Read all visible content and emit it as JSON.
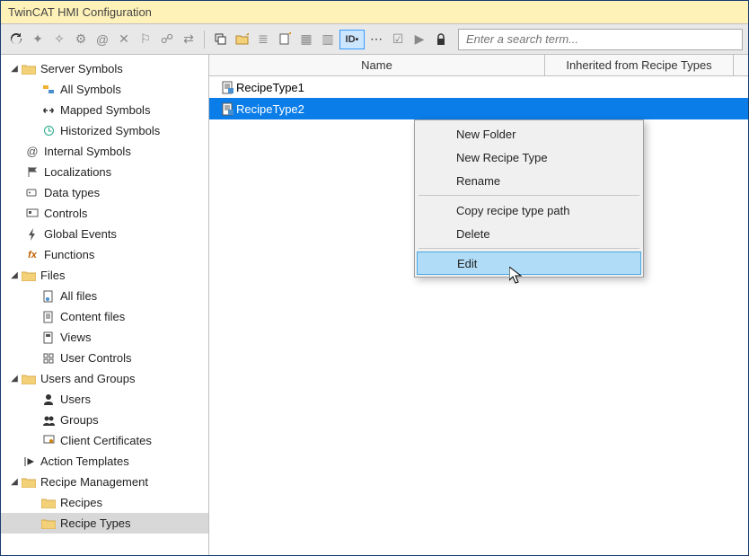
{
  "title": "TwinCAT HMI Configuration",
  "search_placeholder": "Enter a search term...",
  "columns": {
    "name": "Name",
    "inherited": "Inherited from Recipe Types"
  },
  "rows": [
    {
      "label": "RecipeType1"
    },
    {
      "label": "RecipeType2"
    }
  ],
  "context_menu": {
    "new_folder": "New Folder",
    "new_recipe_type": "New Recipe Type",
    "rename": "Rename",
    "copy_path": "Copy recipe type path",
    "delete": "Delete",
    "edit": "Edit"
  },
  "tree": {
    "server_symbols": "Server Symbols",
    "all_symbols": "All Symbols",
    "mapped_symbols": "Mapped Symbols",
    "historized_symbols": "Historized Symbols",
    "internal_symbols": "Internal Symbols",
    "localizations": "Localizations",
    "data_types": "Data types",
    "controls": "Controls",
    "global_events": "Global Events",
    "functions": "Functions",
    "files": "Files",
    "all_files": "All files",
    "content_files": "Content files",
    "views": "Views",
    "user_controls": "User Controls",
    "users_and_groups": "Users and Groups",
    "users": "Users",
    "groups": "Groups",
    "client_certificates": "Client Certificates",
    "action_templates": "Action Templates",
    "recipe_management": "Recipe Management",
    "recipes": "Recipes",
    "recipe_types": "Recipe Types"
  }
}
